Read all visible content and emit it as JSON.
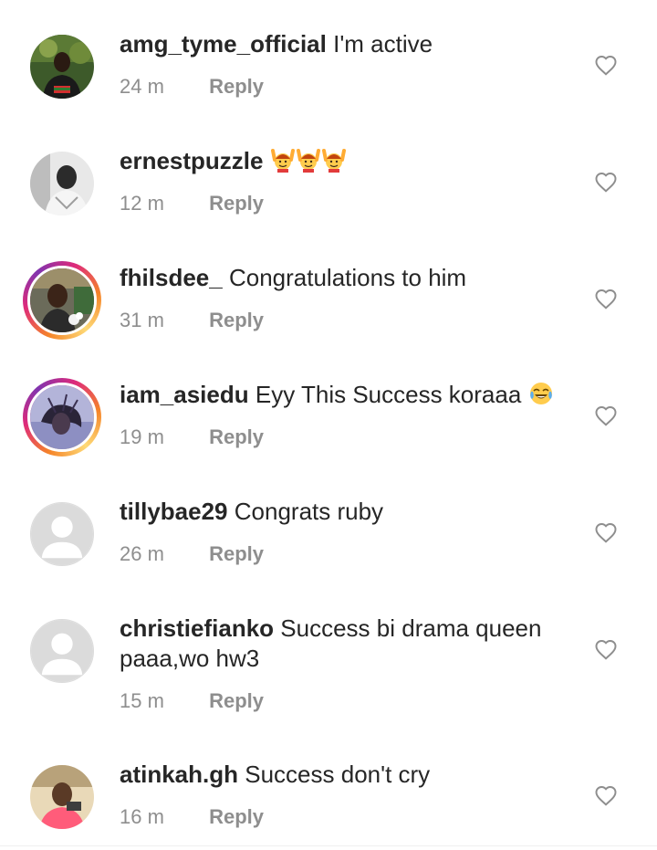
{
  "comments": [
    {
      "username": "amg_tyme_official",
      "text": "I'm active",
      "time": "24 m",
      "reply_label": "Reply",
      "avatar": "photo",
      "story_ring": false
    },
    {
      "username": "ernestpuzzle",
      "text": "",
      "emoji": [
        "person-raising-hands-emoji",
        "person-raising-hands-emoji",
        "person-raising-hands-emoji"
      ],
      "time": "12 m",
      "reply_label": "Reply",
      "avatar": "photo",
      "story_ring": false
    },
    {
      "username": "fhilsdee_",
      "text": "Congratulations to him",
      "time": "31 m",
      "reply_label": "Reply",
      "avatar": "photo",
      "story_ring": true
    },
    {
      "username": "iam_asiedu",
      "text": "Eyy This Success koraaa",
      "emoji": [
        "tears-of-joy-emoji"
      ],
      "time": "19 m",
      "reply_label": "Reply",
      "avatar": "photo",
      "story_ring": true
    },
    {
      "username": "tillybae29",
      "text": "Congrats ruby",
      "time": "26 m",
      "reply_label": "Reply",
      "avatar": "default",
      "story_ring": false
    },
    {
      "username": "christiefianko",
      "text": "Success bi drama queen paaa,wo hw3",
      "time": "15 m",
      "reply_label": "Reply",
      "avatar": "default",
      "story_ring": false
    },
    {
      "username": "atinkah.gh",
      "text": "Success don't cry",
      "time": "16 m",
      "reply_label": "Reply",
      "avatar": "photo",
      "story_ring": false
    }
  ],
  "colors": {
    "text": "#262626",
    "meta": "#8e8e8e",
    "story_ring_start": "#f58529",
    "story_ring_end": "#dd2a7b"
  }
}
